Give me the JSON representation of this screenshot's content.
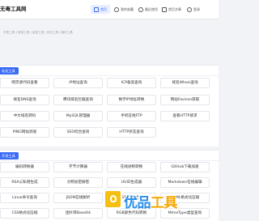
{
  "header": {
    "brand": "无毒工具网",
    "nav": [
      {
        "label": "首页",
        "icon": "home-icon",
        "active": true
      },
      {
        "label": "我的收藏",
        "icon": "heart-icon",
        "active": false
      },
      {
        "label": "最近使用",
        "icon": "clock-icon",
        "active": false
      },
      {
        "label": "首页文章",
        "icon": "doc-icon",
        "active": false
      },
      {
        "label": "登录",
        "icon": "user-icon",
        "active": false
      }
    ]
  },
  "breadcrumb": "开发工具 | 常用工具 | 信息工具 | 安全工具 | 娱乐工具",
  "sections": [
    {
      "title": "站长工具",
      "items": [
        "网页源代码查看",
        "IP地址查询",
        "ICP备案查询",
        "域名Whois查询",
        "域名DNS查询",
        "腾讯域名拦截查询",
        "数字IP地址转换",
        "网站Favicon获取",
        "中文域名转码",
        "MySQL管理器",
        "手机在线FTP",
        "查看HTTP请求",
        "PING网站测速",
        "SEO综合查询",
        "HTTP状态查询"
      ]
    },
    {
      "title": "开发工具",
      "items": [
        "编码转换器",
        "字节计算器",
        "在线进制转换",
        "GitHub下载加速",
        "RSA公私钥生成",
        "对称加密解密",
        "UUID生成器",
        "Markdown在线编辑",
        "Linux命令查询",
        "JSON在线解析",
        "JS代码格式化",
        "HTML格式化压缩",
        "CSS格式化压缩",
        "图片转Base64",
        "RGB颜色代码转换",
        "MimeType类型查询"
      ]
    }
  ],
  "watermark": {
    "part1": "优品",
    "part2": "工具"
  }
}
